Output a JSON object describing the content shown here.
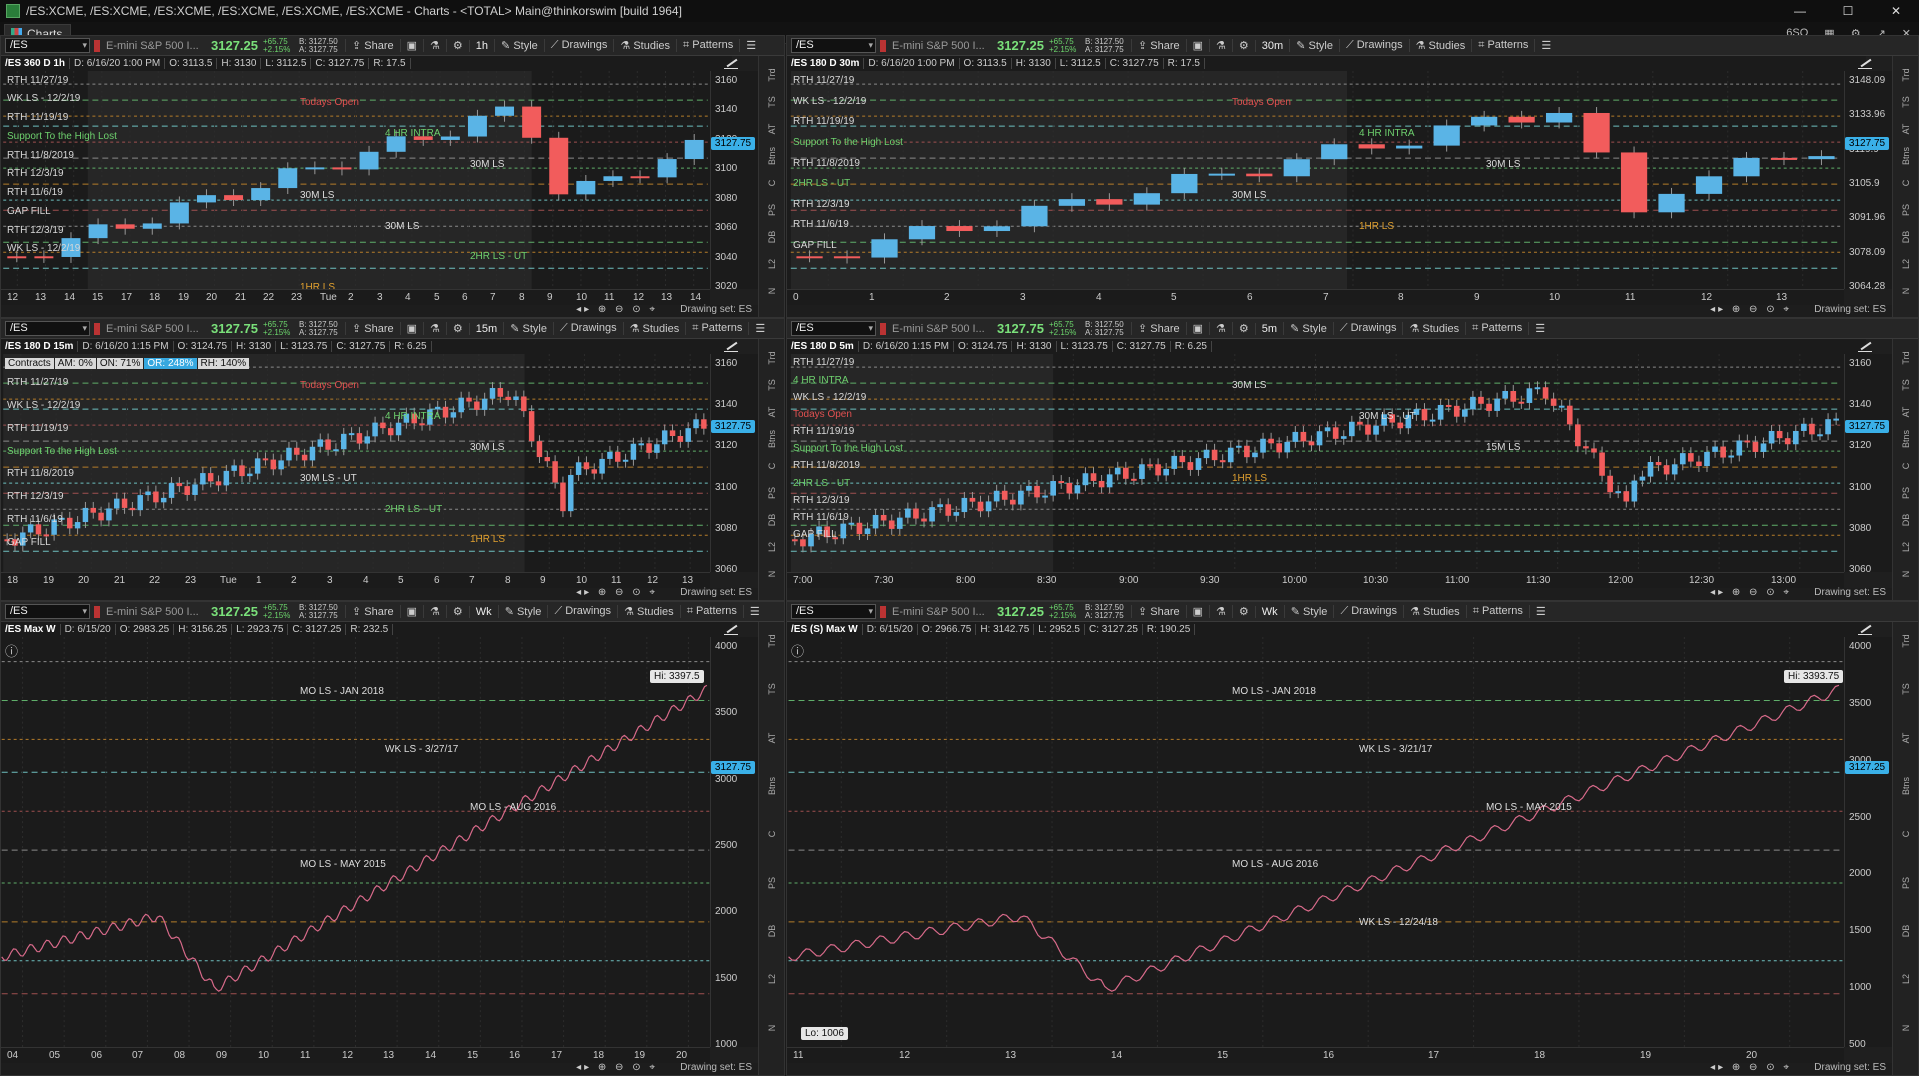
{
  "window": {
    "title": "/ES:XCME, /ES:XCME, /ES:XCME, /ES:XCME, /ES:XCME, /ES:XCME - Charts - <TOTAL> Main@thinkorswim [build 1964]",
    "tab_label": "Charts",
    "right_label": "6SQ"
  },
  "common": {
    "symbol": "/ES",
    "desc": "E-mini S&P 500 I...",
    "change": "+65.75",
    "change_pct": "+2.15%",
    "bid": "B: 3127.50",
    "ask": "A: 3127.75",
    "share": "Share",
    "style": "Style",
    "drawings": "Drawings",
    "studies": "Studies",
    "patterns": "Patterns",
    "drawing_set": "Drawing set: ES",
    "side_tabs": [
      "Trd",
      "TS",
      "AT",
      "Btns",
      "C",
      "PS",
      "DB",
      "L2",
      "N"
    ]
  },
  "panels": [
    {
      "price": "3127.25",
      "agg": "1h",
      "info": {
        "name": "/ES 360 D 1h",
        "d": "D: 6/16/20 1:00 PM",
        "o": "O: 3113.5",
        "h": "H: 3130",
        "l": "L: 3112.5",
        "c": "C: 3127.75",
        "r": "R: 17.5"
      },
      "scale": [
        "3160",
        "3140",
        "3120",
        "3100",
        "3080",
        "3060",
        "3040",
        "3020"
      ],
      "last": "3127.75",
      "times": [
        "12",
        "13",
        "14",
        "15",
        "17",
        "18",
        "19",
        "20",
        "21",
        "22",
        "23",
        "Tue",
        "2",
        "3",
        "4",
        "5",
        "6",
        "7",
        "8",
        "9",
        "10",
        "11",
        "12",
        "13",
        "14"
      ],
      "labels_left": [
        "RTH 11/27/19",
        "WK LS - 12/2/19",
        "RTH 11/19/19",
        "Support To the High Lost",
        "RTH 11/8/2019",
        "RTH 12/3/19",
        "RTH 11/6/19",
        "GAP FILL",
        "RTH 12/3/19",
        "WK LS - 12/2/19"
      ],
      "labels_mid": [
        "Todays Open",
        "4 HR INTRA",
        "30M LS",
        "30M LS",
        "30M LS",
        "2HR LS - UT",
        "1HR LS"
      ]
    },
    {
      "price": "3127.25",
      "agg": "30m",
      "info": {
        "name": "/ES 180 D 30m",
        "d": "D: 6/16/20 1:00 PM",
        "o": "O: 3113.5",
        "h": "H: 3130",
        "l": "L: 3112.5",
        "c": "C: 3127.75",
        "r": "R: 17.5"
      },
      "scale": [
        "3148.09",
        "3133.96",
        "3119.9",
        "3105.9",
        "3091.96",
        "3078.09",
        "3064.28"
      ],
      "last": "3127.75",
      "times": [
        "0",
        "1",
        "2",
        "3",
        "4",
        "5",
        "6",
        "7",
        "8",
        "9",
        "10",
        "11",
        "12",
        "13"
      ],
      "labels_left": [
        "RTH 11/27/19",
        "WK LS - 12/2/19",
        "RTH 11/19/19",
        "Support To the High Lost",
        "RTH 11/8/2019",
        "2HR LS - UT",
        "RTH 12/3/19",
        "RTH 11/6/19",
        "GAP FILL"
      ],
      "labels_mid": [
        "Todays Open",
        "4 HR INTRA",
        "30M LS",
        "30M LS",
        "1HR LS"
      ]
    },
    {
      "price": "3127.75",
      "agg": "15m",
      "info": {
        "name": "/ES 180 D 15m",
        "d": "D: 6/16/20 1:15 PM",
        "o": "O: 3124.75",
        "h": "H: 3130",
        "l": "L: 3123.75",
        "c": "C: 3127.75",
        "r": "R: 6.25"
      },
      "chips": [
        "Contracts",
        "AM: 0%",
        "ON: 71%",
        "OR: 248%",
        "RH: 140%"
      ],
      "scale": [
        "3160",
        "3140",
        "3120",
        "3100",
        "3080",
        "3060"
      ],
      "last": "3127.75",
      "times": [
        "18",
        "19",
        "20",
        "21",
        "22",
        "23",
        "Tue",
        "1",
        "2",
        "3",
        "4",
        "5",
        "6",
        "7",
        "8",
        "9",
        "10",
        "11",
        "12",
        "13"
      ],
      "labels_left": [
        "RTH 11/27/19",
        "WK LS - 12/2/19",
        "RTH 11/19/19",
        "Support To the High Lost",
        "RTH 11/8/2019",
        "RTH 12/3/19",
        "RTH 11/6/19",
        "GAP FILL"
      ],
      "labels_mid": [
        "Todays Open",
        "4 HR INTRA",
        "30M LS",
        "30M LS - UT",
        "2HR LS - UT",
        "1HR LS"
      ]
    },
    {
      "price": "3127.75",
      "agg": "5m",
      "info": {
        "name": "/ES 180 D 5m",
        "d": "D: 6/16/20 1:15 PM",
        "o": "O: 3124.75",
        "h": "H: 3130",
        "l": "L: 3123.75",
        "c": "C: 3127.75",
        "r": "R: 6.25"
      },
      "scale": [
        "3160",
        "3140",
        "3120",
        "3100",
        "3080",
        "3060"
      ],
      "last": "3127.75",
      "times": [
        "7:00",
        "7:30",
        "8:00",
        "8:30",
        "9:00",
        "9:30",
        "10:00",
        "10:30",
        "11:00",
        "11:30",
        "12:00",
        "12:30",
        "13:00"
      ],
      "labels_left": [
        "RTH 11/27/19",
        "4 HR INTRA",
        "WK LS - 12/2/19",
        "Todays Open",
        "RTH 11/19/19",
        "Support To the High Lost",
        "RTH 11/8/2019",
        "2HR LS - UT",
        "RTH 12/3/19",
        "RTH 11/6/19",
        "GAP FILL"
      ],
      "labels_mid": [
        "30M LS",
        "30M LS - UT",
        "15M LS",
        "1HR LS"
      ]
    },
    {
      "price": "3127.25",
      "agg": "Wk",
      "info": {
        "name": "/ES Max W",
        "d": "D: 6/15/20",
        "o": "O: 2983.25",
        "h": "H: 3156.25",
        "l": "L: 2923.75",
        "c": "C: 3127.25",
        "r": "R: 232.5"
      },
      "scale": [
        "4000",
        "3500",
        "3000",
        "2500",
        "2000",
        "1500",
        "1000"
      ],
      "last": "3127.75",
      "hi": "Hi: 3397.5",
      "times": [
        "04",
        "05",
        "06",
        "07",
        "08",
        "09",
        "10",
        "11",
        "12",
        "13",
        "14",
        "15",
        "16",
        "17",
        "18",
        "19",
        "20"
      ],
      "labels_mid": [
        "MO LS - JAN 2018",
        "WK LS - 3/27/17",
        "MO LS - AUG 2016",
        "MO LS - MAY 2015"
      ]
    },
    {
      "price": "3127.25",
      "agg": "Wk",
      "info": {
        "name": "/ES (S) Max W",
        "d": "D: 6/15/20",
        "o": "O: 2966.75",
        "h": "H: 3142.75",
        "l": "L: 2952.5",
        "c": "C: 3127.25",
        "r": "R: 190.25"
      },
      "scale": [
        "4000",
        "3500",
        "3000",
        "2500",
        "2000",
        "1500",
        "1000",
        "500"
      ],
      "last": "3127.25",
      "hi": "Hi: 3393.75",
      "lo": "Lo: 1006",
      "times": [
        "11",
        "12",
        "13",
        "14",
        "15",
        "16",
        "17",
        "18",
        "19",
        "20"
      ],
      "labels_mid": [
        "MO LS - JAN 2018",
        "WK LS - 3/21/17",
        "MO LS - MAY 2015",
        "MO LS - AUG 2016",
        "WK LS - 12/24/18"
      ]
    }
  ]
}
